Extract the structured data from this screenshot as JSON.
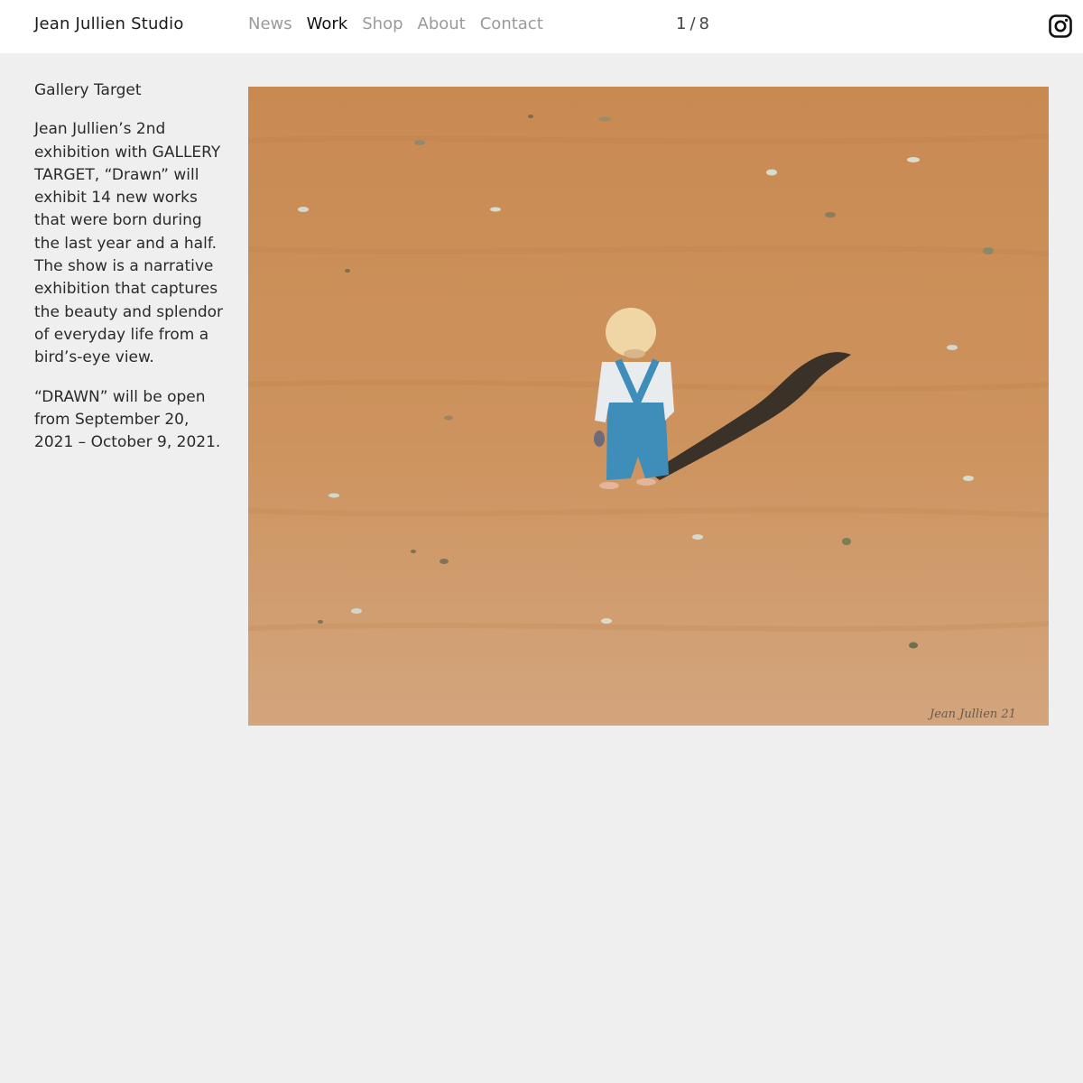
{
  "header": {
    "brand": "Jean Jullien Studio",
    "nav": [
      {
        "label": "News",
        "active": false
      },
      {
        "label": "Work",
        "active": true
      },
      {
        "label": "Shop",
        "active": false
      },
      {
        "label": "About",
        "active": false
      },
      {
        "label": "Contact",
        "active": false
      }
    ],
    "counter": {
      "current": "1",
      "separator": "/",
      "total": "8"
    },
    "social_icon": "instagram-icon"
  },
  "project": {
    "title": "Gallery Target",
    "paragraphs": [
      "Jean Jullien’s 2nd exhibition with GALLERY TARGET, “Drawn” will exhibit 14 new works that were born during the last year and a half. The show is a narrative exhibition that captures the beauty and splendor of everyday life from a bird’s-eye view.",
      "“DRAWN” will be open from September 20, 2021 – October 9, 2021."
    ]
  },
  "artwork": {
    "signature": "Jean Jullien 21",
    "colors": {
      "ground": "#c98d55",
      "ground_light": "#d4a27a",
      "shadow": "#3a3128",
      "shirt": "#e8ecef",
      "overalls": "#3f8db9",
      "hair": "#f0d6a4"
    }
  },
  "colors": {
    "background": "#efefef",
    "header": "#ffffff",
    "nav_inactive": "#9a9a9a",
    "nav_active": "#111111"
  }
}
